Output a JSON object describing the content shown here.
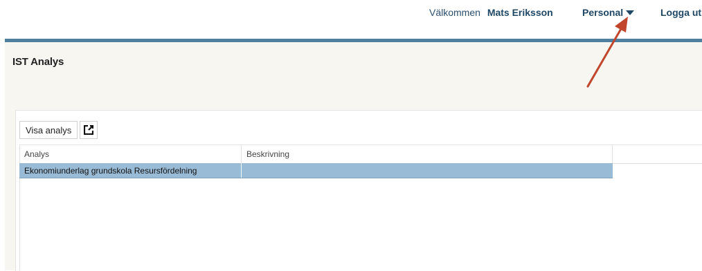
{
  "header": {
    "welcome_text": "Välkommen",
    "user_name": "Mats Eriksson",
    "menu_label": "Personal",
    "logout_label": "Logga ut"
  },
  "page": {
    "title": "IST Analys"
  },
  "toolbar": {
    "show_analysis_label": "Visa analys",
    "export_icon": "external-link-icon"
  },
  "grid": {
    "columns": [
      "Analys",
      "Beskrivning"
    ],
    "rows": [
      {
        "analys": "Ekonomiunderlag grundskola Resursfördelning",
        "beskrivning": "",
        "selected": true
      }
    ]
  },
  "colors": {
    "accent": "#4f7fa0",
    "selected_row": "#99bbd6",
    "annotation_arrow": "#c0452b"
  }
}
